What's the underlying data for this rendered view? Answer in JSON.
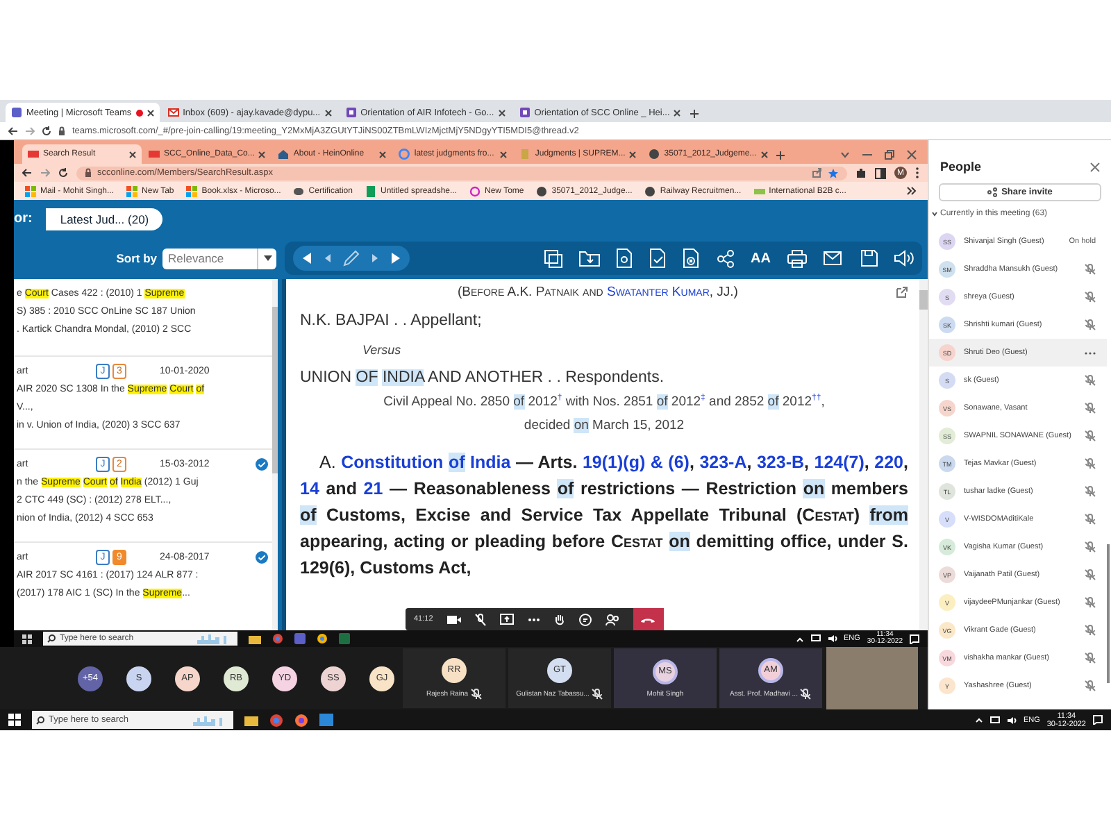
{
  "outer_browser": {
    "tabs": [
      {
        "title": "Meeting | Microsoft Teams",
        "kind": "teams",
        "selected": true,
        "recording": true
      },
      {
        "title": "Inbox (609) - ajay.kavade@dypu...",
        "kind": "gmail",
        "selected": false,
        "recording": false
      },
      {
        "title": "Orientation of AIR Infotech - Go...",
        "kind": "form",
        "selected": false,
        "recording": false
      },
      {
        "title": "Orientation of SCC Online _ Hei...",
        "kind": "form",
        "selected": false,
        "recording": false
      }
    ],
    "address": "teams.microsoft.com/_#/pre-join-calling/19:meeting_Y2MxMjA3ZGUtYTJiNS00ZTBmLWIzMjctMjY5NDgyYTI5MDI5@thread.v2"
  },
  "shared_screen": {
    "browser": {
      "tabs": [
        {
          "title": "Search Result",
          "kind": "scc",
          "selected": true
        },
        {
          "title": "SCC_Online_Data_Co...",
          "kind": "scc",
          "selected": false
        },
        {
          "title": "About - HeinOnline",
          "kind": "hein",
          "selected": false
        },
        {
          "title": "latest judgments fro...",
          "kind": "google",
          "selected": false
        },
        {
          "title": "Judgments | SUPREM...",
          "kind": "court",
          "selected": false
        },
        {
          "title": "35071_2012_Judgeme...",
          "kind": "globe",
          "selected": false
        }
      ],
      "address": "scconline.com/Members/SearchResult.aspx",
      "profile_initial": "M",
      "bookmarks": [
        {
          "title": "Mail - Mohit Singh...",
          "kind": "ms"
        },
        {
          "title": "New Tab",
          "kind": "ms"
        },
        {
          "title": "Book.xlsx - Microso...",
          "kind": "ms"
        },
        {
          "title": "Certification",
          "kind": "cert"
        },
        {
          "title": "Untitled spreadshe...",
          "kind": "sheets"
        },
        {
          "title": "New Tome",
          "kind": "tome"
        },
        {
          "title": "35071_2012_Judge...",
          "kind": "globe"
        },
        {
          "title": "Railway Recruitmen...",
          "kind": "globe"
        },
        {
          "title": "International B2B c...",
          "kind": "b2b"
        }
      ]
    },
    "header": {
      "label": "or:",
      "chip": "Latest Jud... (20)"
    },
    "sort": {
      "label": "Sort by",
      "value": "Relevance"
    },
    "toolbar": {
      "font_size_label": "AA"
    },
    "results": [
      {
        "checked": false,
        "lines": [
          [
            {
              "text": "e "
            },
            {
              "text": "Court",
              "highlighted": true
            },
            {
              "text": " Cases 422 : (2010) 1 "
            },
            {
              "text": "Supreme",
              "highlighted": true
            }
          ],
          [
            {
              "text": "S) 385 : 2010 SCC OnLine SC 187 Union"
            }
          ],
          [
            {
              "text": ". Kartick Chandra Mondal, (2010) 2 SCC"
            }
          ]
        ]
      },
      {
        "heading": "art",
        "badges": [
          {
            "text": "J",
            "kind": "type",
            "filled": false
          },
          {
            "text": "3",
            "kind": "count",
            "filled": false
          }
        ],
        "date": "10-01-2020",
        "checked": false,
        "lines": [
          [
            {
              "text": "AIR 2020 SC 1308 In the "
            },
            {
              "text": "Supreme Court of",
              "highlighted": true
            }
          ],
          [
            {
              "text": "V...,"
            }
          ],
          [
            {
              "text": "in v. Union of India, (2020) 3 SCC 637"
            }
          ]
        ]
      },
      {
        "heading": "art",
        "badges": [
          {
            "text": "J",
            "kind": "type",
            "filled": false
          },
          {
            "text": "2",
            "kind": "count",
            "filled": false
          }
        ],
        "date": "15-03-2012",
        "checked": true,
        "lines": [
          [
            {
              "text": "n the "
            },
            {
              "text": "Supreme Court of India",
              "highlighted": true
            },
            {
              "text": " (2012) 1 Guj"
            }
          ],
          [
            {
              "text": "2 CTC 449 (SC) : (2012) 278 ELT...,"
            }
          ],
          [
            {
              "text": "nion of India, (2012) 4 SCC 653"
            }
          ]
        ]
      },
      {
        "heading": "art",
        "badges": [
          {
            "text": "J",
            "kind": "type",
            "filled": false
          },
          {
            "text": "9",
            "kind": "count",
            "filled": true
          }
        ],
        "date": "24-08-2017",
        "checked": true,
        "lines": [
          [
            {
              "text": "AIR 2017 SC 4161 : (2017) 124 ALR 877 :"
            }
          ],
          [
            {
              "text": "(2017) 178 AIC 1 (SC) In the "
            },
            {
              "text": "Supreme",
              "highlighted": true
            },
            {
              "text": "..."
            }
          ]
        ]
      }
    ],
    "document": {
      "paragraphs": [
        {
          "kind": "bench",
          "segments": [
            {
              "text": "(Before A.K. Patnaik and "
            },
            {
              "text": "Swatanter Kumar",
              "link": true
            },
            {
              "text": ", JJ.)"
            }
          ]
        },
        {
          "kind": "party",
          "segments": [
            {
              "text": "N.K. BAJPAI . . Appellant;"
            }
          ]
        },
        {
          "kind": "versus",
          "segments": [
            {
              "text": "Versus"
            }
          ]
        },
        {
          "kind": "party",
          "segments": [
            {
              "text": "UNION "
            },
            {
              "text": "OF INDIA",
              "highlighted": true
            },
            {
              "text": " AND ANOTHER . . Respondents."
            }
          ]
        },
        {
          "kind": "appeal",
          "segments": [
            {
              "text": "Civil Appeal No. 2850 "
            },
            {
              "text": "of",
              "highlighted": true
            },
            {
              "text": " 2012"
            },
            {
              "text": "†",
              "superscript": true
            },
            {
              "text": " with Nos. 2851 "
            },
            {
              "text": "of",
              "highlighted": true
            },
            {
              "text": " 2012"
            },
            {
              "text": "‡",
              "superscript": true
            },
            {
              "text": " and 2852 "
            },
            {
              "text": "of",
              "highlighted": true
            },
            {
              "text": " 2012"
            },
            {
              "text": "††",
              "superscript": true
            },
            {
              "text": ","
            }
          ]
        },
        {
          "kind": "appeal",
          "segments": [
            {
              "text": "decided "
            },
            {
              "text": "on",
              "highlighted": true
            },
            {
              "text": " March 15, 2012"
            }
          ]
        },
        {
          "kind": "headnote",
          "label": "A.",
          "segments": [
            {
              "text": "Constitution ",
              "link": true
            },
            {
              "text": "of",
              "link": true,
              "highlighted": true
            },
            {
              "text": " India",
              "link": true
            },
            {
              "text": " — Arts. "
            },
            {
              "text": "19(1)(g) & (6)",
              "link": true
            },
            {
              "text": ", "
            },
            {
              "text": "323-A",
              "link": true
            },
            {
              "text": ", "
            },
            {
              "text": "323-B",
              "link": true
            },
            {
              "text": ", "
            },
            {
              "text": "124(7)",
              "link": true
            },
            {
              "text": ", "
            },
            {
              "text": "220",
              "link": true
            },
            {
              "text": ", "
            },
            {
              "text": "14",
              "link": true
            },
            {
              "text": " and "
            },
            {
              "text": "21",
              "link": true
            },
            {
              "text": " — Reasonableness "
            },
            {
              "text": "of",
              "highlighted": true
            },
            {
              "text": " restrictions — Restriction "
            },
            {
              "text": "on",
              "highlighted": true
            },
            {
              "text": " members "
            },
            {
              "text": "of",
              "highlighted": true
            },
            {
              "text": " Customs, Excise and Service Tax Appellate Tribunal ("
            },
            {
              "text": "Cestat",
              "small_caps": true
            },
            {
              "text": ") "
            },
            {
              "text": "from",
              "highlighted": true
            },
            {
              "text": " appearing, acting or pleading before "
            },
            {
              "text": "Cestat ",
              "small_caps": true
            },
            {
              "text": "on",
              "highlighted": true
            },
            {
              "text": " demitting office, under S. 129(6), Customs Act,"
            }
          ]
        }
      ]
    },
    "call_controls": {
      "timer": "41:12"
    },
    "taskbar": {
      "search_placeholder": "Type here to search",
      "language": "ENG",
      "time": "11:34",
      "date": "30-12-2022"
    }
  },
  "meeting_strip": {
    "avatars": [
      {
        "initials": "+54",
        "color": "#6264a7"
      },
      {
        "initials": "S",
        "color": "#c9d5f0"
      },
      {
        "initials": "AP",
        "color": "#f6d5ca"
      },
      {
        "initials": "RB",
        "color": "#dfe9d3"
      },
      {
        "initials": "YD",
        "color": "#f5d3e2"
      },
      {
        "initials": "SS",
        "color": "#eed3d3"
      },
      {
        "initials": "GJ",
        "color": "#f8e3c6"
      }
    ],
    "tiles": [
      {
        "initials": "RR",
        "name": "Rajesh Raina",
        "color": "#f8e0c4",
        "muted": true,
        "active": false
      },
      {
        "initials": "GT",
        "name": "Gulistan Naz Tabassu...",
        "color": "#d3def0",
        "muted": true,
        "active": false
      },
      {
        "initials": "MS",
        "name": "Mohit Singh",
        "color": "#e8d2e0",
        "muted": false,
        "active": true
      },
      {
        "initials": "AM",
        "name": "Asst. Prof. Madhavi ...",
        "color": "#f2cfd8",
        "muted": true,
        "active": true
      }
    ]
  },
  "people_panel": {
    "title": "People",
    "share_button": "Share invite",
    "section": "Currently in this meeting (63)",
    "members": [
      {
        "initials": "SS",
        "name": "Shivanjal Singh (Guest)",
        "color": "#dcd6f2",
        "status": "On hold",
        "muted": false,
        "selected": false
      },
      {
        "initials": "SM",
        "name": "Shraddha Mansukh (Guest)",
        "color": "#cfe0ef",
        "muted": true,
        "selected": false
      },
      {
        "initials": "S",
        "name": "shreya (Guest)",
        "color": "#e2dcf3",
        "muted": true,
        "selected": false
      },
      {
        "initials": "SK",
        "name": "Shrishti kumari (Guest)",
        "color": "#cddbf0",
        "muted": true,
        "selected": false
      },
      {
        "initials": "SD",
        "name": "Shruti Deo (Guest)",
        "color": "#f6d3cc",
        "muted": false,
        "selected": true
      },
      {
        "initials": "S",
        "name": "sk (Guest)",
        "color": "#d4dcf4",
        "muted": true,
        "selected": false
      },
      {
        "initials": "VS",
        "name": "Sonawane, Vasant",
        "color": "#f6d6cc",
        "muted": true,
        "selected": false
      },
      {
        "initials": "SS",
        "name": "SWAPNIL SONAWANE (Guest)",
        "color": "#e2ecd6",
        "muted": true,
        "selected": false
      },
      {
        "initials": "TM",
        "name": "Tejas Mavkar (Guest)",
        "color": "#cbd9ef",
        "muted": true,
        "selected": false
      },
      {
        "initials": "TL",
        "name": "tushar ladke (Guest)",
        "color": "#dfe5dc",
        "muted": true,
        "selected": false
      },
      {
        "initials": "V",
        "name": "V-WISDOMAditiKale",
        "color": "#d7defa",
        "muted": true,
        "selected": false
      },
      {
        "initials": "VK",
        "name": "Vagisha Kumar (Guest)",
        "color": "#d6ebd9",
        "muted": true,
        "selected": false
      },
      {
        "initials": "VP",
        "name": "Vaijanath Patil (Guest)",
        "color": "#ecdcd9",
        "muted": true,
        "selected": false
      },
      {
        "initials": "V",
        "name": "vijaydeePMunjankar (Guest)",
        "color": "#fbeec0",
        "muted": true,
        "selected": false
      },
      {
        "initials": "VG",
        "name": "Vikrant Gade (Guest)",
        "color": "#fbe8c8",
        "muted": true,
        "selected": false
      },
      {
        "initials": "VM",
        "name": "vishakha mankar (Guest)",
        "color": "#f8d8dc",
        "muted": true,
        "selected": false
      },
      {
        "initials": "Y",
        "name": "Yashashree (Guest)",
        "color": "#fbe5cc",
        "muted": true,
        "selected": false
      }
    ]
  },
  "taskbar": {
    "search_placeholder": "Type here to search",
    "language": "ENG",
    "time": "11:34",
    "date": "30-12-2022"
  }
}
